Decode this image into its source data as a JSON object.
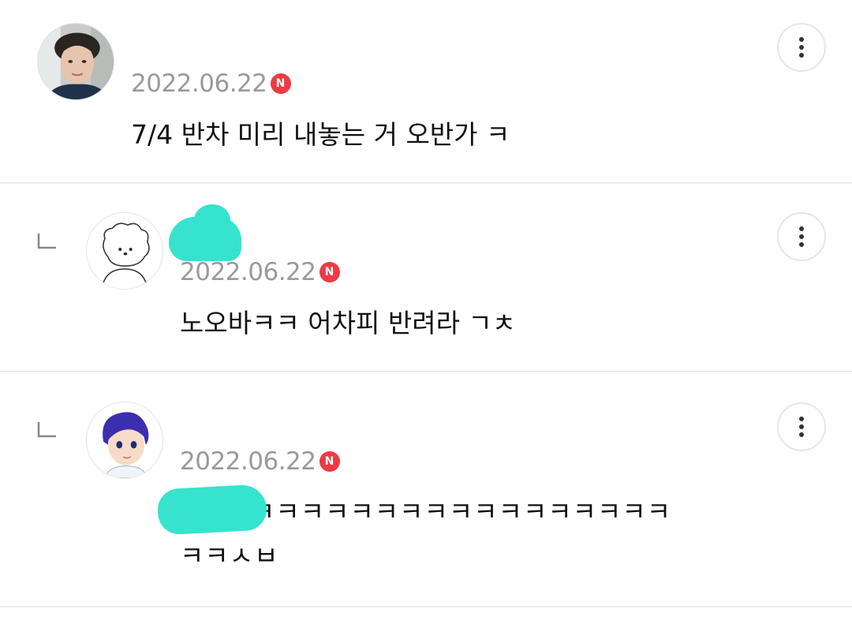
{
  "comments": [
    {
      "date": "2022.06.22",
      "badge": "N",
      "text": "7/4 반차 미리 내놓는 거 오반가 ㅋ"
    },
    {
      "date": "2022.06.22",
      "badge": "N",
      "text": "노오바ㅋㅋ 어차피 반려라 ㄱㅊ"
    },
    {
      "date": "2022.06.22",
      "badge": "N",
      "text_line1": "ㅋㅋㅋㅋㅋㅋㅋㅋㅋㅋㅋㅋㅋㅋㅋㅋㅋ",
      "text_line2": "ㅋㅋㅅㅂ"
    }
  ],
  "colors": {
    "badge": "#ee3a43",
    "date": "#9a9a9a",
    "redaction": "#35e3cf",
    "divider": "#ebebeb"
  },
  "icons": {
    "reply": "reply-arrow-icon",
    "more": "more-vertical-icon",
    "new": "new-badge-icon"
  }
}
